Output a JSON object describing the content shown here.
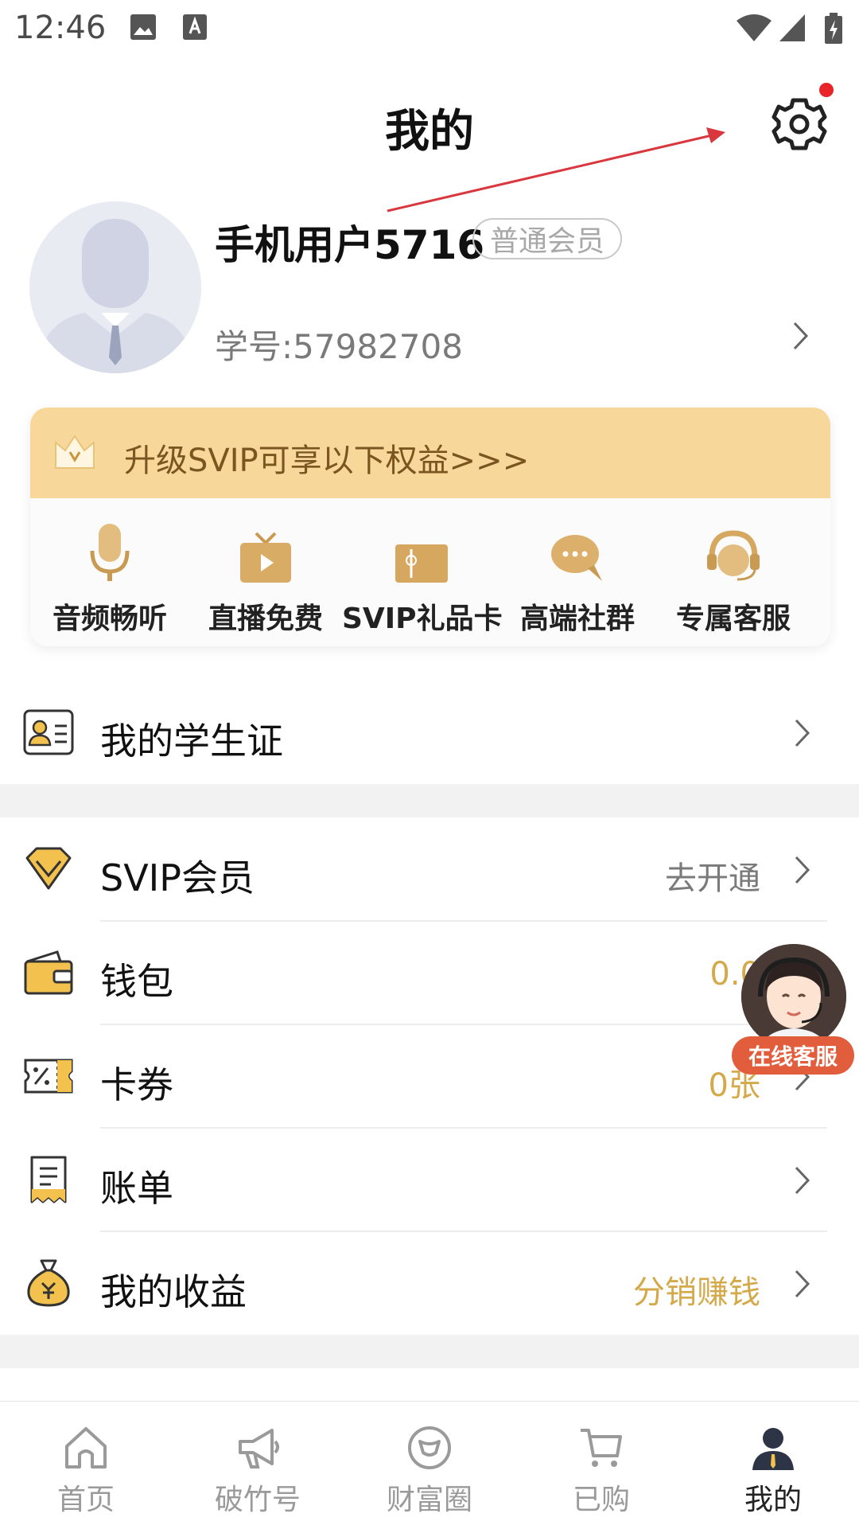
{
  "status_bar": {
    "time": "12:46"
  },
  "header": {
    "title": "我的"
  },
  "profile": {
    "username": "手机用户5716",
    "member_level": "普通会员",
    "student_id": "学号:57982708"
  },
  "svip_card": {
    "banner_text": "升级SVIP可享以下权益>>>",
    "perks": [
      {
        "label": "音频畅听",
        "icon": "microphone-icon"
      },
      {
        "label": "直播免费",
        "icon": "live-tv-icon"
      },
      {
        "label": "SVIP礼品卡",
        "icon": "gift-card-icon"
      },
      {
        "label": "高端社群",
        "icon": "chat-bubble-icon"
      },
      {
        "label": "专属客服",
        "icon": "customer-service-icon"
      }
    ]
  },
  "menu": {
    "student_card": {
      "label": "我的学生证"
    },
    "svip": {
      "label": "SVIP会员",
      "value": "去开通"
    },
    "wallet": {
      "label": "钱包",
      "value": "0.0"
    },
    "coupons": {
      "label": "卡券",
      "value": "0张"
    },
    "bills": {
      "label": "账单"
    },
    "earnings": {
      "label": "我的收益",
      "value": "分销赚钱"
    }
  },
  "floating_service": {
    "label": "在线客服"
  },
  "tabbar": [
    {
      "label": "首页",
      "icon": "home-icon"
    },
    {
      "label": "破竹号",
      "icon": "megaphone-icon"
    },
    {
      "label": "财富圈",
      "icon": "wealth-circle-icon"
    },
    {
      "label": "已购",
      "icon": "cart-icon"
    },
    {
      "label": "我的",
      "icon": "profile-icon",
      "active": true
    }
  ],
  "colors": {
    "gold_text": "#d4a94a",
    "svip_banner": "#f7d89a",
    "notification_dot": "#e8232a",
    "annotation_arrow": "#d9363e",
    "service_badge": "#e25d3c"
  }
}
